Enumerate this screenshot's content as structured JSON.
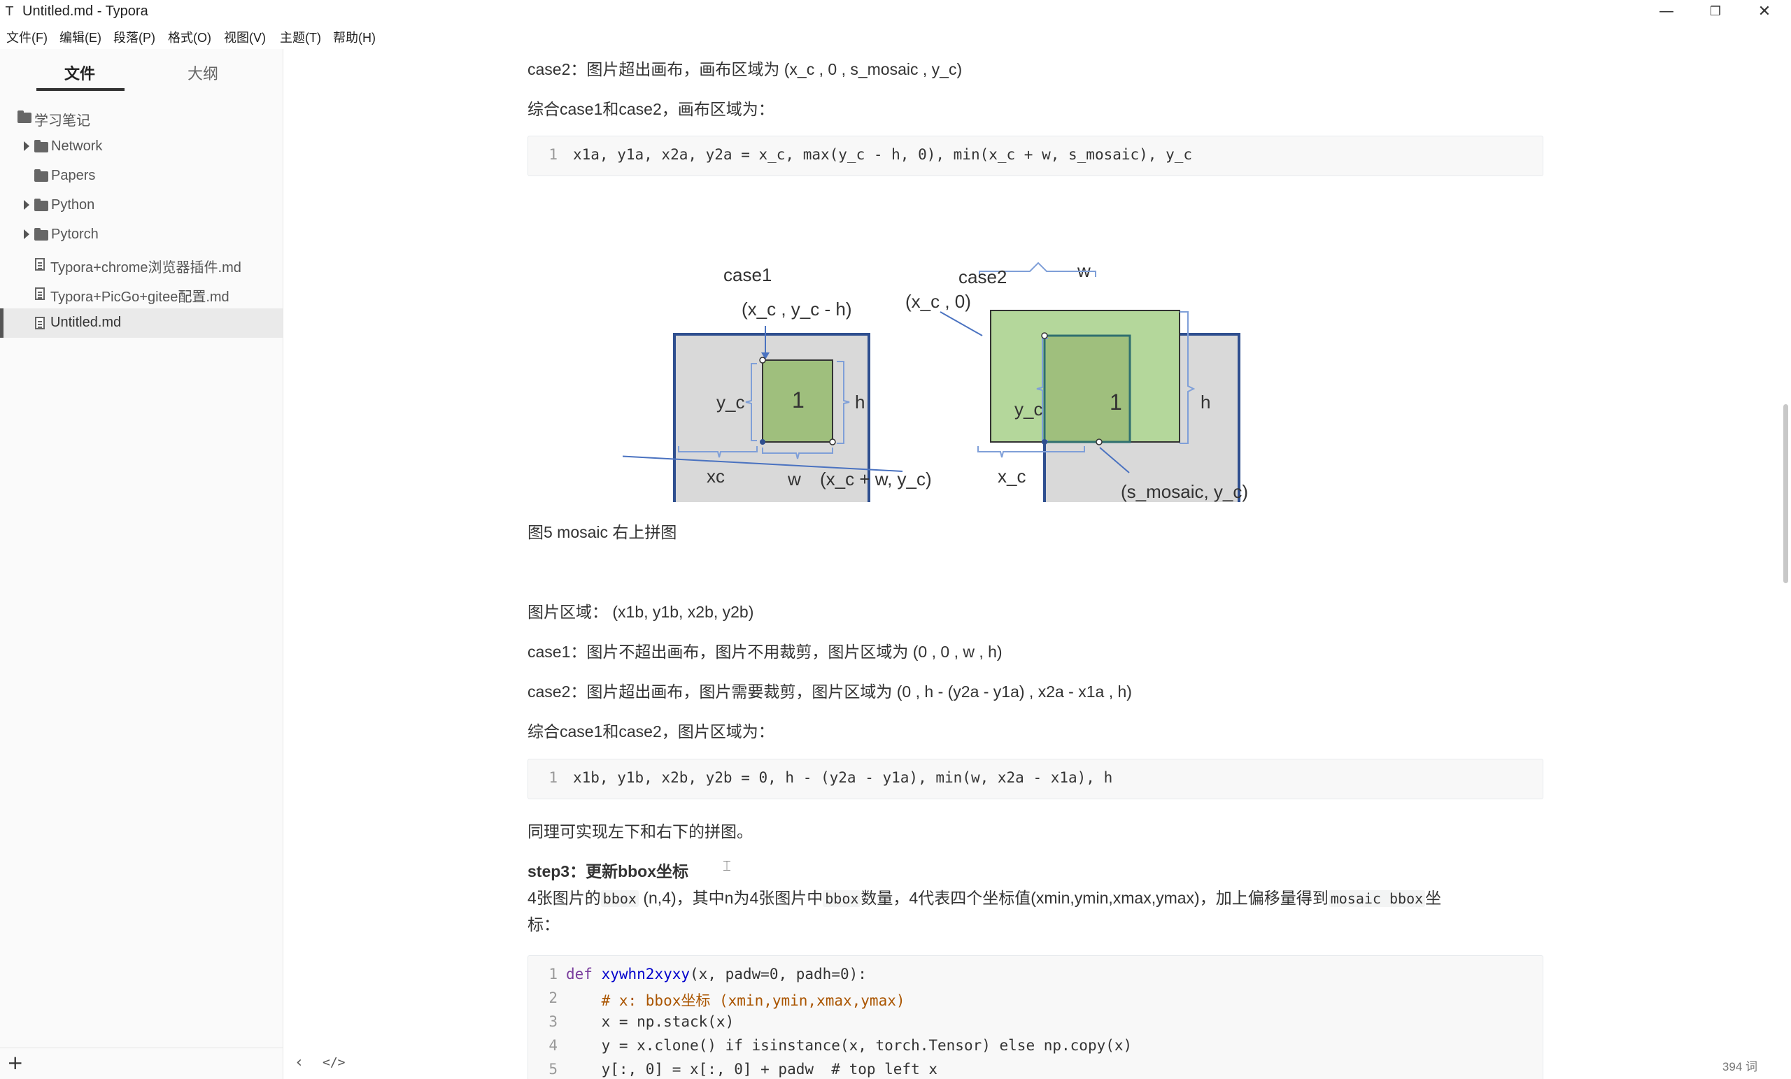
{
  "window": {
    "title": "Untitled.md - Typora",
    "app_icon": "T",
    "minimize": "—",
    "restore": "❐",
    "close": "✕"
  },
  "menu": [
    "文件(F)",
    "编辑(E)",
    "段落(P)",
    "格式(O)",
    "视图(V)",
    "主题(T)",
    "帮助(H)"
  ],
  "sidebar": {
    "tabs": {
      "files": "文件",
      "outline": "大纲"
    },
    "tree": [
      {
        "label": "学习笔记",
        "type": "folder",
        "icon": "folder-icon"
      },
      {
        "label": "Network",
        "type": "folder",
        "icon": "folder-icon",
        "collapsed": true
      },
      {
        "label": "Papers",
        "type": "folder",
        "icon": "folder-icon"
      },
      {
        "label": "Python",
        "type": "folder",
        "icon": "folder-icon",
        "collapsed": true
      },
      {
        "label": "Pytorch",
        "type": "folder",
        "icon": "folder-icon",
        "collapsed": true
      },
      {
        "label": "Typora+chrome浏览器插件.md",
        "type": "file",
        "icon": "file-icon"
      },
      {
        "label": "Typora+PicGo+gitee配置.md",
        "type": "file",
        "icon": "file-icon"
      },
      {
        "label": "Untitled.md",
        "type": "file",
        "icon": "file-icon",
        "active": true
      }
    ],
    "add_button": "+"
  },
  "doc": {
    "p_case2_canvas": "case2：图片超出画布，画布区域为 (x_c , 0 , s_mosaic , y_c)",
    "p_combine_canvas": "综合case1和case2，画布区域为：",
    "code1": {
      "line_no": "1",
      "line": "x1a, y1a, x2a, y2a = x_c, max(y_c - h, 0), min(x_c + w, s_mosaic), y_c"
    },
    "figure": {
      "case1_title": "case1",
      "case1_top_label": "(x_c , y_c - h)",
      "case1_yc": "y_c",
      "case1_h": "h",
      "case1_img": "1",
      "case1_xc": "xc",
      "case1_w": "w",
      "case1_corner": "(x_c + w, y_c)",
      "case2_title": "case2",
      "case2_w": "w",
      "case2_origin": "(x_c , 0)",
      "case2_yc": "y_c",
      "case2_img": "1",
      "case2_h": "h",
      "case2_xc": "x_c",
      "case2_corner": "(s_mosaic, y_c)"
    },
    "caption": "图5 mosaic 右上拼图",
    "p_img_region": "图片区域： (x1b, y1b, x2b, y2b)",
    "p_case1_img": "case1：图片不超出画布，图片不用裁剪，图片区域为 (0 , 0 , w , h)",
    "p_case2_img": "case2：图片超出画布，图片需要裁剪，图片区域为 (0 , h - (y2a - y1a) , x2a - x1a , h)",
    "p_combine_img": "综合case1和case2，图片区域为：",
    "code2": {
      "line_no": "1",
      "line": "x1b, y1b, x2b, y2b = 0, h - (y2a - y1a), min(w, x2a - x1a), h"
    },
    "p_similar": "同理可实现左下和右下的拼图。",
    "heading_step3": "step3：更新bbox坐标",
    "cursor_glyph": "⌶",
    "para_bbox": {
      "t1": "4张图片的",
      "c1": "bbox",
      "t2": " (n,4)，其中n为4张图片中",
      "c2": "bbox",
      "t3": "数量，4代表四个坐标值(xmin,ymin,xmax,ymax)，加上偏移量得到",
      "c3": "mosaic bbox",
      "t4": "坐",
      "t5": "标："
    },
    "code3": {
      "line_numbers": [
        "1",
        "2",
        "3",
        "4",
        "5"
      ],
      "l1": {
        "kw": "def",
        "fn": "xywhn2xyxy",
        "rest": "(x, padw=0, padh=0):"
      },
      "l2": "    # x: bbox坐标 (xmin,ymin,xmax,ymax)",
      "l3": "    x = np.stack(x)",
      "l4": "    y = x.clone() if isinstance(x, torch.Tensor) else np.copy(x)",
      "l5": "    y[:, 0] = x[:, 0] + padw  # top left x"
    }
  },
  "status": {
    "toggle_sidebar": "‹",
    "source_mode": "</>",
    "word_count": "394 词"
  }
}
